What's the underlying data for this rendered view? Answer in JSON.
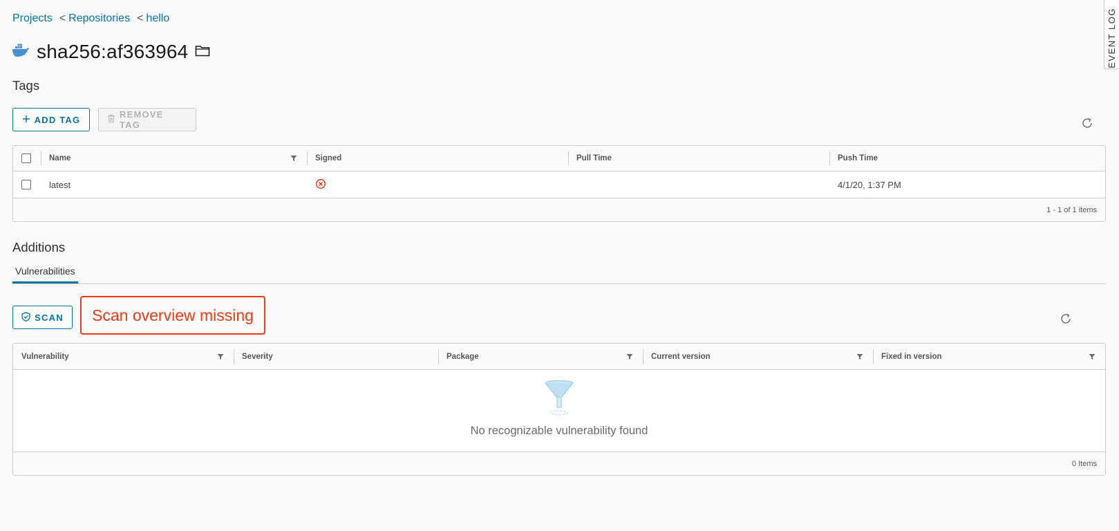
{
  "breadcrumb": {
    "projects": "Projects",
    "sep": "<",
    "repositories": "Repositories",
    "repo": "hello"
  },
  "artifact": {
    "title": "sha256:af363964",
    "icon": "docker-whale-icon",
    "folder_icon": "folder-icon"
  },
  "tags": {
    "heading": "Tags",
    "add_label": "ADD TAG",
    "remove_label": "REMOVE TAG",
    "columns": [
      "Name",
      "Signed",
      "Pull Time",
      "Push Time"
    ],
    "rows": [
      {
        "name": "latest",
        "signed": "not-signed",
        "pull_time": "",
        "push_time": "4/1/20, 1:37 PM"
      }
    ],
    "footer": "1 - 1 of 1 items"
  },
  "additions": {
    "heading": "Additions",
    "tab": "Vulnerabilities",
    "scan_label": "SCAN",
    "annotation": "Scan overview missing",
    "columns": [
      "Vulnerability",
      "Severity",
      "Package",
      "Current version",
      "Fixed in version"
    ],
    "empty_text": "No recognizable vulnerability found",
    "footer": "0 Items"
  },
  "event_log": "EVENT LOG",
  "colors": {
    "accent": "#0072a3",
    "annotation": "#ee3a12",
    "error": "#e62700"
  }
}
